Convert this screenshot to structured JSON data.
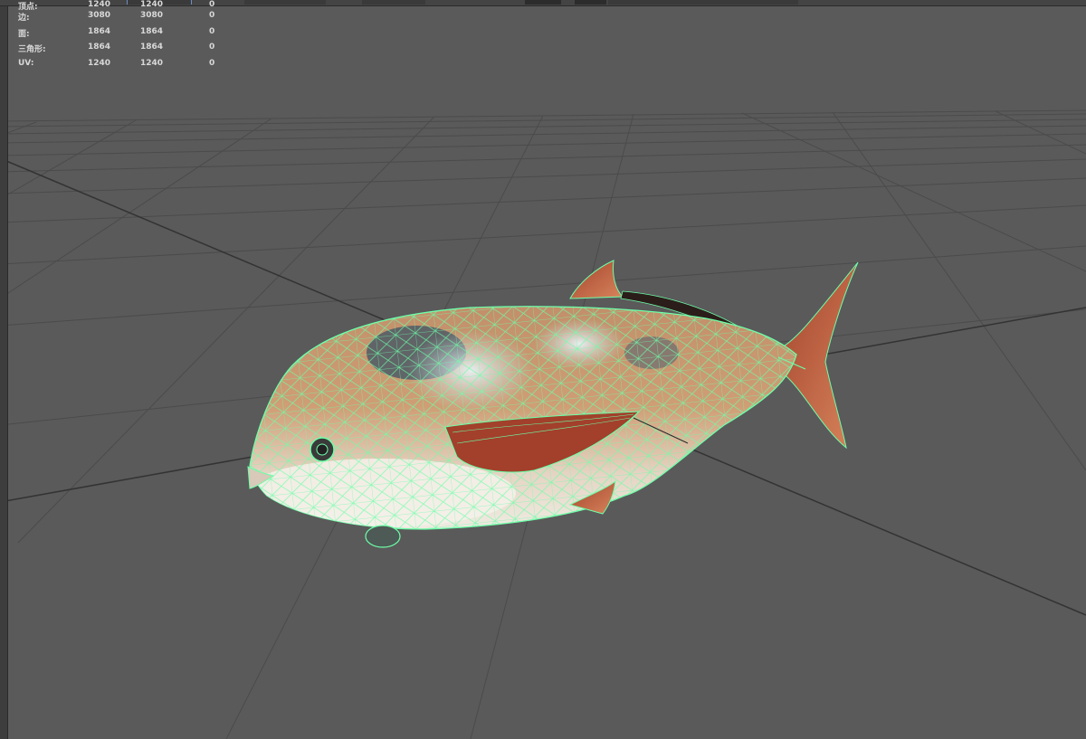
{
  "hud": {
    "rows": [
      {
        "label": "顶点:",
        "v1": "1240",
        "v2": "1240",
        "v3": "0"
      },
      {
        "label": "边:",
        "v1": "3080",
        "v2": "3080",
        "v3": "0"
      },
      {
        "label": "面:",
        "v1": "1864",
        "v2": "1864",
        "v3": "0"
      },
      {
        "label": "三角形:",
        "v1": "1864",
        "v2": "1864",
        "v3": "0"
      },
      {
        "label": "UV:",
        "v1": "1240",
        "v2": "1240",
        "v3": "0"
      }
    ]
  },
  "colors": {
    "viewport_bg": "#5a5a5a",
    "grid_line": "#4b4b4b",
    "grid_axis": "#333333",
    "wireframe": "#6dffa8",
    "hud_text": "#d8d8d8"
  },
  "icons": [
    "toolbar-strip-icons"
  ]
}
